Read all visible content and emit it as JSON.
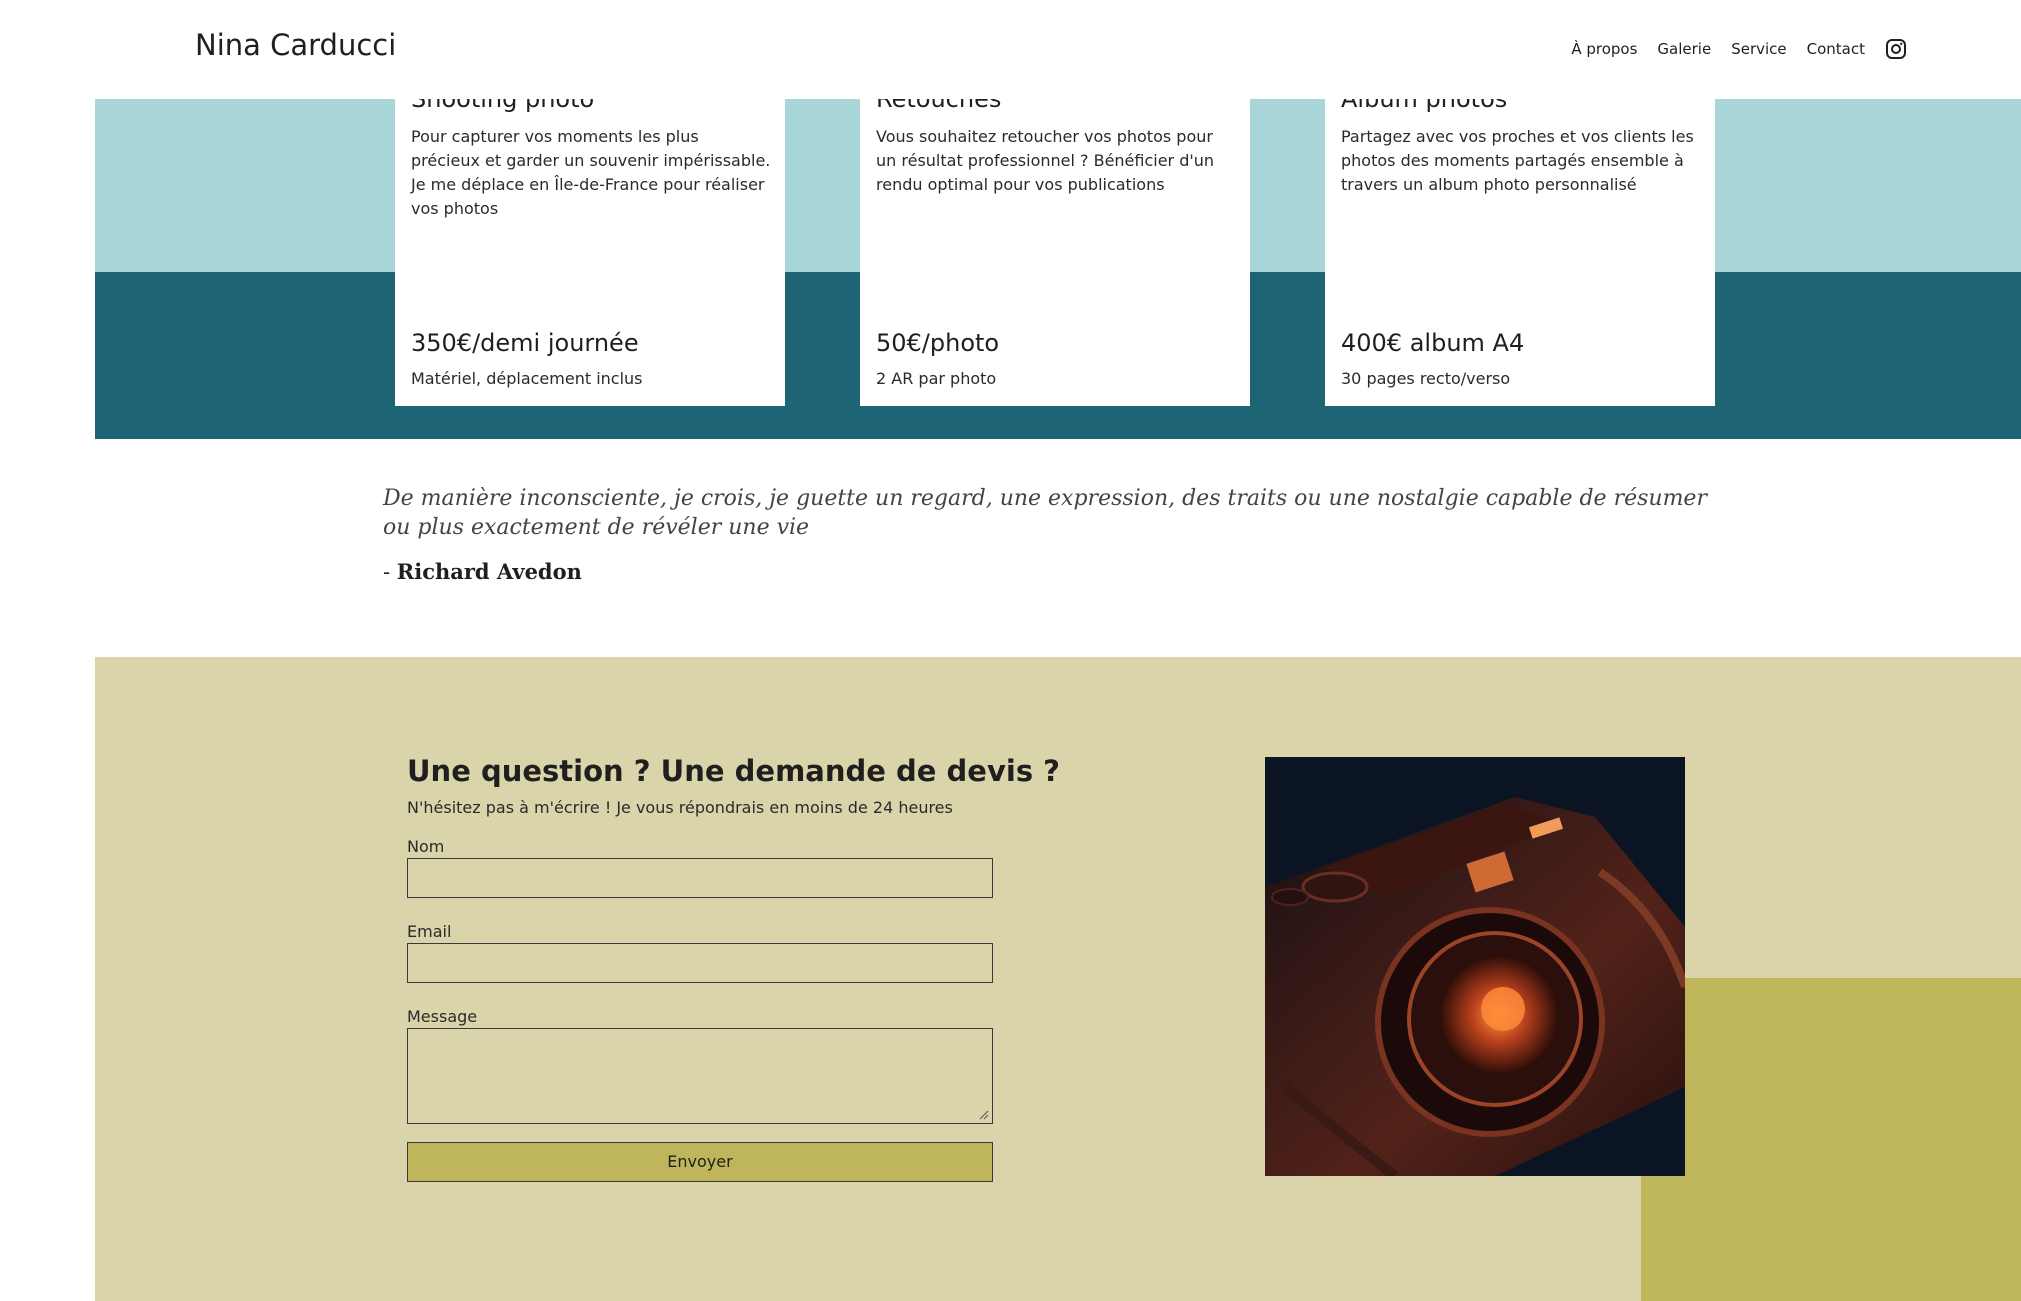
{
  "header": {
    "brand": "Nina Carducci",
    "nav": [
      "À propos",
      "Galerie",
      "Service",
      "Contact"
    ],
    "instagram_icon": "instagram-icon"
  },
  "services": {
    "cards": [
      {
        "title": "Shooting photo",
        "description": "Pour capturer vos moments les plus précieux et garder un souvenir impérissable. Je me déplace en Île-de-France pour réaliser vos photos",
        "price": "350€/demi journée",
        "note": "Matériel, déplacement inclus"
      },
      {
        "title": "Retouches",
        "description": "Vous souhaitez retoucher vos photos pour un résultat professionnel ? Bénéficier d'un rendu optimal pour vos publications",
        "price": "50€/photo",
        "note": "2 AR par photo"
      },
      {
        "title": "Album photos",
        "description": "Partagez avec vos proches et vos clients les photos des moments partagés ensemble à travers un album photo personnalisé",
        "price": "400€ album A4",
        "note": "30 pages recto/verso"
      }
    ]
  },
  "quote": {
    "text": "De manière inconsciente, je crois, je guette un regard, une expression, des traits ou une nostalgie capable de résumer ou plus exactement de révéler une vie",
    "author_prefix": "- ",
    "author": "Richard Avedon"
  },
  "contact": {
    "title": "Une question ? Une demande de devis ?",
    "subtitle": "N'hésitez pas à m'écrire ! Je vous répondrais en moins de 24 heures",
    "name_label": "Nom",
    "email_label": "Email",
    "message_label": "Message",
    "submit_label": "Envoyer",
    "name_value": "",
    "email_value": "",
    "message_value": "",
    "photo_icon": "camera-photo"
  },
  "colors": {
    "light_teal": "#a8d5d8",
    "dark_teal": "#1d6475",
    "sand": "#d9d4aa",
    "olive": "#bfb55a"
  }
}
